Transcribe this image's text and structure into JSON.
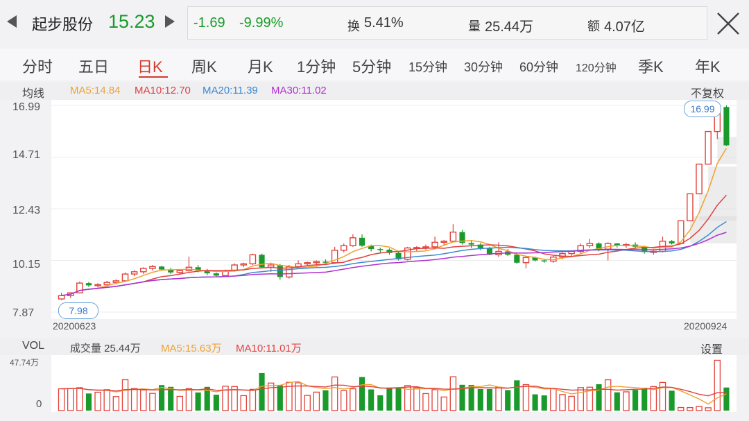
{
  "header": {
    "stock_name": "起步股份",
    "price": "15.23",
    "change": "-1.69",
    "change_pct": "-9.99%",
    "turnover_label": "换",
    "turnover_value": "5.41%",
    "volume_label": "量",
    "volume_value": "25.44万",
    "amount_label": "额",
    "amount_value": "4.07亿"
  },
  "tabs": [
    "分时",
    "五日",
    "日K",
    "周K",
    "月K",
    "1分钟",
    "5分钟",
    "15分钟",
    "30分钟",
    "60分钟",
    "120分钟",
    "季K",
    "年K"
  ],
  "active_tab": "日K",
  "ma_bar": {
    "label": "均线",
    "ma5": "MA5:14.84",
    "ma10": "MA10:12.70",
    "ma20": "MA20:11.39",
    "ma30": "MA30:11.02",
    "adjust": "不复权"
  },
  "colors": {
    "up": "#e0423a",
    "down": "#1a9a2a",
    "ma5": "#f0a030",
    "ma10": "#e04040",
    "ma20": "#3a8ad0",
    "ma30": "#b030d0"
  },
  "chart": {
    "y_ticks": [
      "16.99",
      "14.71",
      "12.43",
      "10.15",
      "7.87"
    ],
    "start_date": "20200623",
    "end_date": "20200924",
    "high_label": "16.99",
    "low_label": "7.98"
  },
  "volume": {
    "label": "VOL",
    "total": "成交量 25.44万",
    "ma5": "MA5:15.63万",
    "ma10": "MA10:11.01万",
    "settings": "设置",
    "max_tick": "47.74万",
    "zero_tick": "0"
  },
  "chart_data": {
    "type": "candlestick",
    "x_range": [
      "20200623",
      "20200924"
    ],
    "ylim": [
      7.87,
      16.99
    ],
    "series_ohlc": [
      [
        8.45,
        8.72,
        8.4,
        8.6
      ],
      [
        8.6,
        8.65,
        8.5,
        8.72
      ],
      [
        8.72,
        9.22,
        8.7,
        9.15
      ],
      [
        9.15,
        9.2,
        8.98,
        9.05
      ],
      [
        9.05,
        9.15,
        8.95,
        9.08
      ],
      [
        9.08,
        9.25,
        9.0,
        9.18
      ],
      [
        9.18,
        9.32,
        9.1,
        9.25
      ],
      [
        9.25,
        9.62,
        9.2,
        9.55
      ],
      [
        9.55,
        9.72,
        9.45,
        9.65
      ],
      [
        9.65,
        9.85,
        9.55,
        9.8
      ],
      [
        9.8,
        9.95,
        9.7,
        9.88
      ],
      [
        9.88,
        9.92,
        9.7,
        9.75
      ],
      [
        9.75,
        9.82,
        9.55,
        9.62
      ],
      [
        9.62,
        9.75,
        9.55,
        9.7
      ],
      [
        9.7,
        10.32,
        9.65,
        9.85
      ],
      [
        9.85,
        9.95,
        9.62,
        9.7
      ],
      [
        9.7,
        9.78,
        9.5,
        9.58
      ],
      [
        9.58,
        9.62,
        9.4,
        9.48
      ],
      [
        9.48,
        9.75,
        9.45,
        9.7
      ],
      [
        9.7,
        10.02,
        9.65,
        9.95
      ],
      [
        9.95,
        10.05,
        9.85,
        10.0
      ],
      [
        10.0,
        10.45,
        9.95,
        10.4
      ],
      [
        10.4,
        10.45,
        9.8,
        9.85
      ],
      [
        9.85,
        10.05,
        9.65,
        9.95
      ],
      [
        9.95,
        10.0,
        9.3,
        9.42
      ],
      [
        9.42,
        9.95,
        9.35,
        9.88
      ],
      [
        9.88,
        10.15,
        9.8,
        10.0
      ],
      [
        10.0,
        10.1,
        9.9,
        10.05
      ],
      [
        10.05,
        10.15,
        9.92,
        10.1
      ],
      [
        10.1,
        10.2,
        9.95,
        10.05
      ],
      [
        10.05,
        10.75,
        10.0,
        10.6
      ],
      [
        10.6,
        10.9,
        10.5,
        10.8
      ],
      [
        10.8,
        11.3,
        10.75,
        11.15
      ],
      [
        11.15,
        11.3,
        10.75,
        10.8
      ],
      [
        10.8,
        10.85,
        10.55,
        10.65
      ],
      [
        10.65,
        10.72,
        10.5,
        10.62
      ],
      [
        10.62,
        10.68,
        10.4,
        10.48
      ],
      [
        10.48,
        10.55,
        10.15,
        10.2
      ],
      [
        10.2,
        10.75,
        10.15,
        10.7
      ],
      [
        10.7,
        10.78,
        10.55,
        10.72
      ],
      [
        10.72,
        10.85,
        10.62,
        10.75
      ],
      [
        10.75,
        11.2,
        10.7,
        10.95
      ],
      [
        10.95,
        11.05,
        10.8,
        11.0
      ],
      [
        11.0,
        11.75,
        10.95,
        11.4
      ],
      [
        11.4,
        11.5,
        10.85,
        10.92
      ],
      [
        10.92,
        11.05,
        10.7,
        10.85
      ],
      [
        10.85,
        10.92,
        10.6,
        10.7
      ],
      [
        10.7,
        10.75,
        10.38,
        10.4
      ],
      [
        10.4,
        10.95,
        10.3,
        10.55
      ],
      [
        10.55,
        10.65,
        10.35,
        10.4
      ],
      [
        10.4,
        10.45,
        10.0,
        10.05
      ],
      [
        10.05,
        10.35,
        9.8,
        10.28
      ],
      [
        10.28,
        10.32,
        10.1,
        10.15
      ],
      [
        10.15,
        10.22,
        10.05,
        10.12
      ],
      [
        10.12,
        10.35,
        10.05,
        10.3
      ],
      [
        10.3,
        10.5,
        10.2,
        10.45
      ],
      [
        10.45,
        10.6,
        10.35,
        10.55
      ],
      [
        10.55,
        10.9,
        10.45,
        10.8
      ],
      [
        10.8,
        11.1,
        10.7,
        10.9
      ],
      [
        10.9,
        10.95,
        10.55,
        10.65
      ],
      [
        10.65,
        10.95,
        10.15,
        10.9
      ],
      [
        10.9,
        10.92,
        10.72,
        10.8
      ],
      [
        10.8,
        10.92,
        10.7,
        10.85
      ],
      [
        10.85,
        10.95,
        10.65,
        10.75
      ],
      [
        10.75,
        10.8,
        10.45,
        10.52
      ],
      [
        10.52,
        10.62,
        10.4,
        10.55
      ],
      [
        10.55,
        11.2,
        10.5,
        11.0
      ],
      [
        11.0,
        11.05,
        10.85,
        10.9
      ],
      [
        10.9,
        11.92,
        10.88,
        11.9
      ],
      [
        11.9,
        13.09,
        11.9,
        13.09
      ],
      [
        13.09,
        14.4,
        13.09,
        14.4
      ],
      [
        14.4,
        15.84,
        14.4,
        15.84
      ],
      [
        15.84,
        16.99,
        15.5,
        16.92
      ],
      [
        16.92,
        16.99,
        15.2,
        15.23
      ]
    ]
  }
}
